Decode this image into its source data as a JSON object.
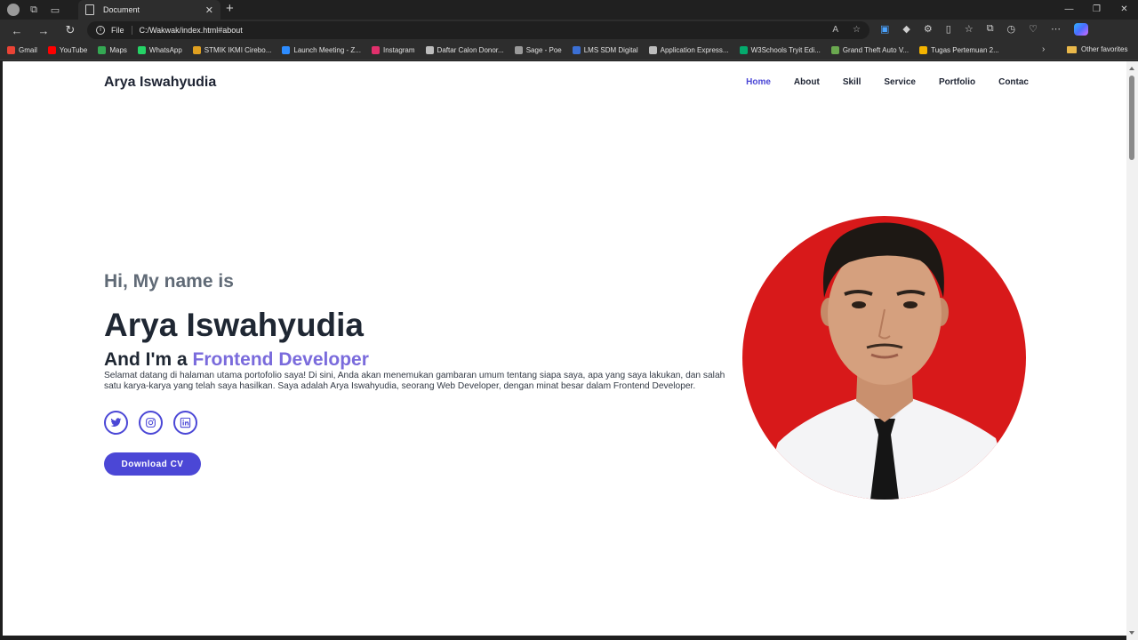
{
  "browser": {
    "tab_title": "Document",
    "address": {
      "scheme_label": "File",
      "url": "C:/Wakwak/index.html#about"
    },
    "bookmarks": [
      {
        "label": "Gmail",
        "color": "#ea4335"
      },
      {
        "label": "YouTube",
        "color": "#ff0000"
      },
      {
        "label": "Maps",
        "color": "#34a853"
      },
      {
        "label": "WhatsApp",
        "color": "#25d366"
      },
      {
        "label": "STMIK IKMI Cirebo...",
        "color": "#e0a020"
      },
      {
        "label": "Launch Meeting - Z...",
        "color": "#2d8cff"
      },
      {
        "label": "Instagram",
        "color": "#e1306c"
      },
      {
        "label": "Daftar Calon Donor...",
        "color": "#bdbdbd"
      },
      {
        "label": "Sage - Poe",
        "color": "#9a9a9a"
      },
      {
        "label": "LMS SDM Digital",
        "color": "#3b6fd4"
      },
      {
        "label": "Application Express...",
        "color": "#bdbdbd"
      },
      {
        "label": "W3Schools Tryit Edi...",
        "color": "#04aa6d"
      },
      {
        "label": "Grand Theft Auto V...",
        "color": "#6aa84f"
      },
      {
        "label": "Tugas Pertemuan 2...",
        "color": "#f4b400"
      }
    ],
    "other_favorites": "Other favorites"
  },
  "site": {
    "logo": "Arya Iswahyudia",
    "nav": [
      "Home",
      "About",
      "Skill",
      "Service",
      "Portfolio",
      "Contac"
    ],
    "active_nav": "Home",
    "accent_color": "#4b47d6"
  },
  "hero": {
    "greeting": "Hi, My name is",
    "name": "Arya Iswahyudia",
    "role_prefix": "And I'm a",
    "role_highlight": "Frontend Developer",
    "description": "Selamat datang di halaman utama portofolio saya! Di sini, Anda akan menemukan gambaran umum tentang siapa saya, apa yang saya lakukan, dan salah satu karya-karya yang telah saya hasilkan. Saya adalah Arya Iswahyudia, seorang Web Developer, dengan minat besar dalam Frontend Developer.",
    "socials": [
      "twitter-icon",
      "instagram-icon",
      "linkedin-icon"
    ],
    "cv_button": "Download CV",
    "photo_background": "#d8191a"
  }
}
